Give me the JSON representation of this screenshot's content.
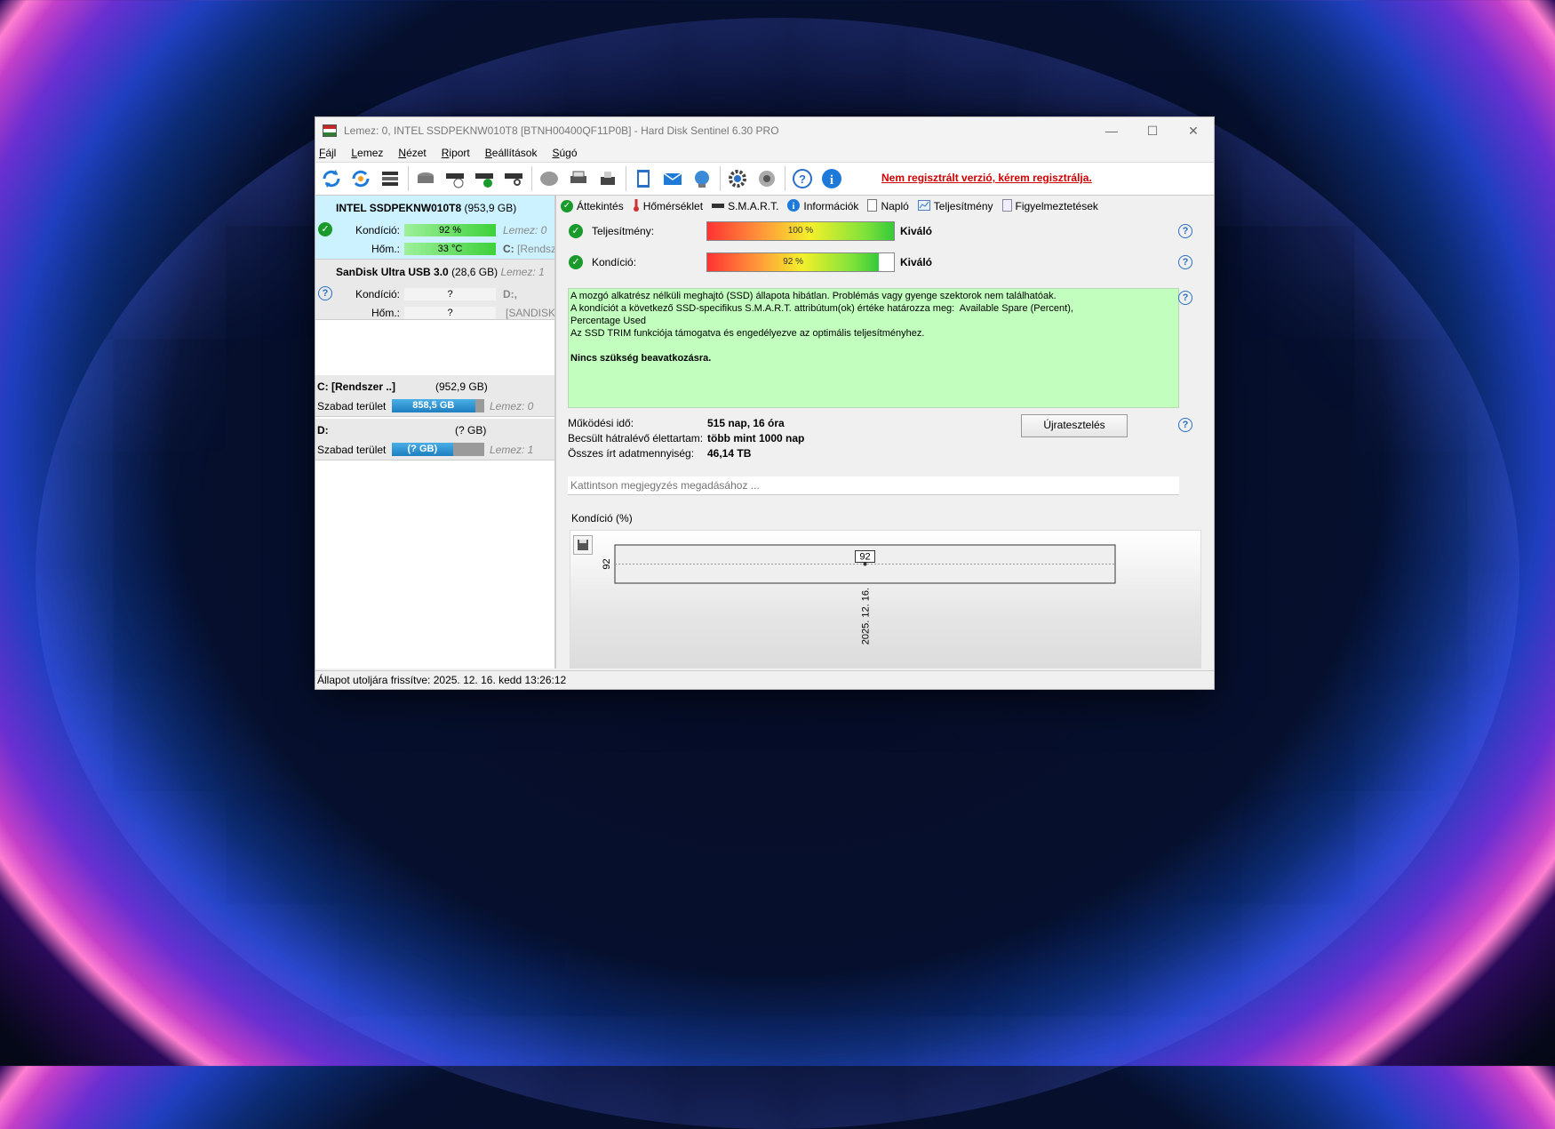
{
  "window": {
    "title": "Lemez: 0, INTEL SSDPEKNW010T8 [BTNH00400QF11P0B]  -  Hard Disk Sentinel 6.30 PRO",
    "controls": {
      "minimize": "—",
      "maximize": "☐",
      "close": "✕"
    }
  },
  "menu": [
    "Fájl",
    "Lemez",
    "Nézet",
    "Riport",
    "Beállítások",
    "Súgó"
  ],
  "toolbar": {
    "icons": [
      "refresh-icon",
      "refresh-all-icon",
      "disk-list-icon",
      "disk-surface-icon",
      "disk-schedule-icon",
      "disk-check-icon",
      "disk-search-icon",
      "disk-gray-icon",
      "printer-icon",
      "fax-icon",
      "report-notepad-icon",
      "email-icon",
      "network-icon",
      "settings-gear-icon",
      "sound-icon",
      "help-icon",
      "info-icon"
    ],
    "register_link": "Nem regisztrált verzió, kérem regisztrálja."
  },
  "disks": [
    {
      "name": "INTEL SSDPEKNW010T8",
      "size": "(953,9 GB)",
      "condition_label": "Kondíció:",
      "condition": "92 %",
      "condition_value": 92,
      "temp_label": "Hőm.:",
      "temp": "33 °C",
      "disk_ref": "Lemez: 0",
      "part_ref": "C:",
      "part_name": "[Rendszer]"
    },
    {
      "name": "SanDisk Ultra USB 3.0",
      "size": "(28,6 GB)",
      "disk_ref": "Lemez: 1",
      "condition_label": "Kondíció:",
      "condition": "?",
      "temp_label": "Hőm.:",
      "temp": "?",
      "part_ref": "D:,",
      "part_name": "[SANDISK]"
    }
  ],
  "partitions": [
    {
      "name": "C: [Rendszer ..]",
      "size": "(952,9 GB)",
      "free_label": "Szabad terület",
      "free": "858,5 GB",
      "free_fraction": 0.9,
      "disk_ref": "Lemez: 0"
    },
    {
      "name": "D:",
      "size": "(? GB)",
      "free_label": "Szabad terület",
      "free": "(? GB)",
      "free_fraction": 0.66,
      "disk_ref": "Lemez: 1"
    }
  ],
  "tabs": [
    "Áttekintés",
    "Hőmérséklet",
    "S.M.A.R.T.",
    "Információk",
    "Napló",
    "Teljesítmény",
    "Figyelmeztetések"
  ],
  "overview": {
    "performance_label": "Teljesítmény:",
    "performance": "100 %",
    "performance_value": 100,
    "performance_verdict": "Kiváló",
    "condition_label": "Kondíció:",
    "condition": "92 %",
    "condition_value": 92,
    "condition_verdict": "Kiváló",
    "description": [
      "A mozgó alkatrész nélküli meghajtó (SSD) állapota hibátlan. Problémás vagy gyenge szektorok nem találhatóak.",
      "A kondíciót a következő SSD-specifikus S.M.A.R.T. attribútum(ok) értéke határozza meg:  Available Spare (Percent),",
      "Percentage Used",
      "Az SSD TRIM funkciója támogatva és engedélyezve az optimális teljesítményhez."
    ],
    "action": "Nincs szükség beavatkozásra.",
    "uptime_label": "Működési idő:",
    "uptime": "515 nap, 16 óra",
    "remaining_label": "Becsült hátralévő élettartam:",
    "remaining": "több mint 1000 nap",
    "written_label": "Összes írt adatmennyiség:",
    "written": "46,14 TB",
    "retest_button": "Újratesztelés",
    "note_placeholder": "Kattintson megjegyzés megadásához ..."
  },
  "chart_data": {
    "type": "line",
    "title": "Kondíció  (%)",
    "x": [
      "2025. 12. 16."
    ],
    "series": [
      {
        "values": [
          92
        ]
      }
    ],
    "yticks": [
      "92"
    ],
    "data_labels": [
      "92"
    ]
  },
  "statusbar": "Állapot utoljára frissítve: 2025. 12. 16. kedd 13:26:12"
}
